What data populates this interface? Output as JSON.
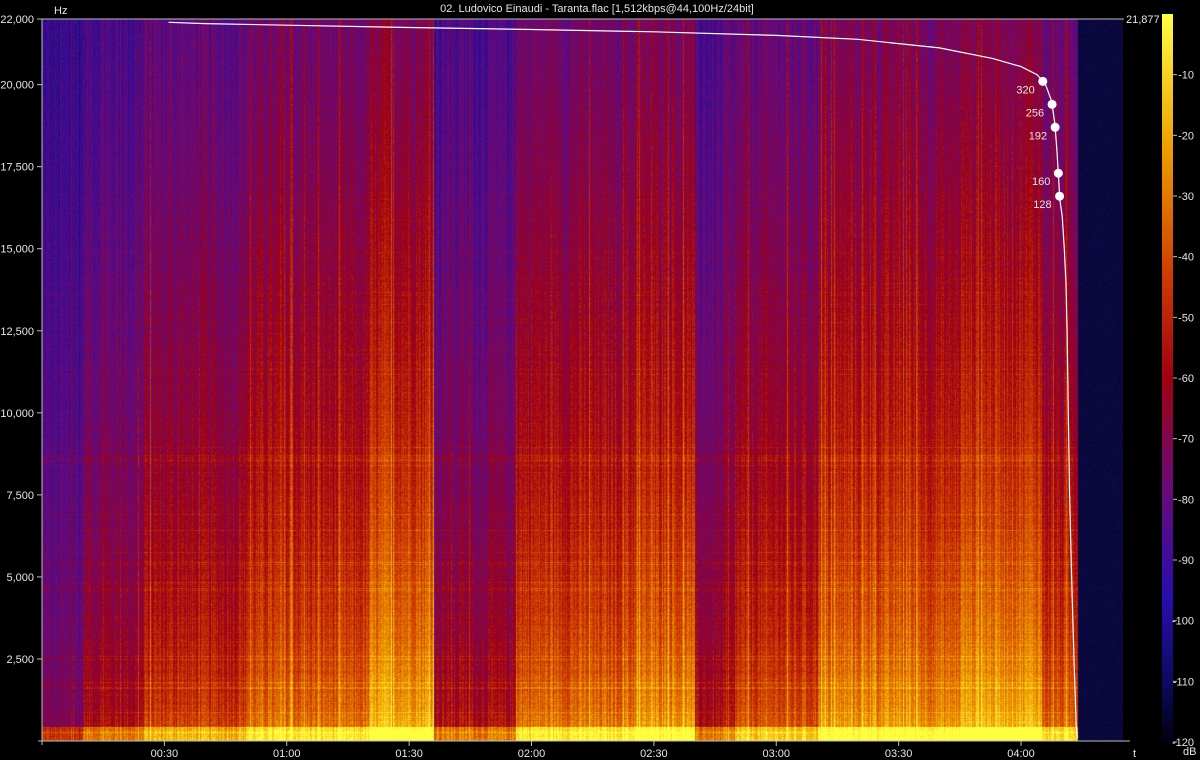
{
  "title": "02. Ludovico Einaudi - Taranta.flac [1,512kbps@44,100Hz/24bit]",
  "chart_data": {
    "type": "heatmap",
    "title": "02. Ludovico Einaudi - Taranta.flac [1,512kbps@44,100Hz/24bit]",
    "ylabel": "Hz",
    "xlabel": "t",
    "ylim": [
      0,
      22000
    ],
    "xlim_seconds": [
      0,
      265
    ],
    "y_ticks": [
      "22,000",
      "20,000",
      "17,500",
      "15,000",
      "12,500",
      "10,000",
      "7,500",
      "5,000",
      "2,500"
    ],
    "y_tick_values": [
      22000,
      20000,
      17500,
      15000,
      12500,
      10000,
      7500,
      5000,
      2500
    ],
    "x_ticks": [
      "00:30",
      "01:00",
      "01:30",
      "02:00",
      "02:30",
      "03:00",
      "03:30",
      "04:00"
    ],
    "x_tick_seconds": [
      30,
      60,
      90,
      120,
      150,
      180,
      210,
      240
    ],
    "max_frequency_label": "21,877",
    "max_frequency": 21877,
    "colorbar": {
      "label": "dB",
      "ticks": [
        "-10",
        "-20",
        "-30",
        "-40",
        "-50",
        "-60",
        "-70",
        "-80",
        "-90",
        "-100",
        "-110",
        "-120"
      ],
      "values": [
        -10,
        -20,
        -30,
        -40,
        -50,
        -60,
        -70,
        -80,
        -90,
        -100,
        -110,
        -120
      ],
      "range": [
        -120,
        0
      ]
    },
    "bitrate_markers": [
      {
        "label": "320",
        "hz": 20100
      },
      {
        "label": "256",
        "hz": 19400
      },
      {
        "label": "192",
        "hz": 18700
      },
      {
        "label": "160",
        "hz": 17300
      },
      {
        "label": "128",
        "hz": 16600
      }
    ],
    "cutoff_curve": [
      {
        "t": 31,
        "hz": 21900
      },
      {
        "t": 40,
        "hz": 21860
      },
      {
        "t": 60,
        "hz": 21810
      },
      {
        "t": 90,
        "hz": 21740
      },
      {
        "t": 120,
        "hz": 21680
      },
      {
        "t": 150,
        "hz": 21610
      },
      {
        "t": 180,
        "hz": 21500
      },
      {
        "t": 200,
        "hz": 21380
      },
      {
        "t": 220,
        "hz": 21120
      },
      {
        "t": 233,
        "hz": 20800
      },
      {
        "t": 240,
        "hz": 20550
      },
      {
        "t": 244,
        "hz": 20300
      },
      {
        "t": 246,
        "hz": 20000
      },
      {
        "t": 247.5,
        "hz": 19500
      },
      {
        "t": 248.3,
        "hz": 18800
      },
      {
        "t": 248.8,
        "hz": 18000
      },
      {
        "t": 249.2,
        "hz": 17200
      },
      {
        "t": 249.5,
        "hz": 16500
      },
      {
        "t": 250.1,
        "hz": 16000
      },
      {
        "t": 250.6,
        "hz": 15000
      },
      {
        "t": 251.0,
        "hz": 14000
      },
      {
        "t": 251.3,
        "hz": 12500
      },
      {
        "t": 251.6,
        "hz": 10000
      },
      {
        "t": 251.9,
        "hz": 7500
      },
      {
        "t": 252.4,
        "hz": 5000
      },
      {
        "t": 253.0,
        "hz": 2500
      },
      {
        "t": 253.5,
        "hz": 500
      },
      {
        "t": 253.8,
        "hz": 100
      }
    ],
    "intensity_profile_note": "",
    "sections": [
      {
        "t0": 0,
        "t1": 10,
        "level": 0.35
      },
      {
        "t0": 10,
        "t1": 25,
        "level": 0.5
      },
      {
        "t0": 25,
        "t1": 50,
        "level": 0.62
      },
      {
        "t0": 50,
        "t1": 80,
        "level": 0.72
      },
      {
        "t0": 80,
        "t1": 96,
        "level": 0.86
      },
      {
        "t0": 96,
        "t1": 116,
        "level": 0.5
      },
      {
        "t0": 116,
        "t1": 145,
        "level": 0.74
      },
      {
        "t0": 145,
        "t1": 160,
        "level": 0.8
      },
      {
        "t0": 160,
        "t1": 170,
        "level": 0.5
      },
      {
        "t0": 170,
        "t1": 190,
        "level": 0.66
      },
      {
        "t0": 190,
        "t1": 225,
        "level": 0.8
      },
      {
        "t0": 225,
        "t1": 245,
        "level": 0.88
      },
      {
        "t0": 245,
        "t1": 255,
        "level": 0.7
      }
    ]
  }
}
